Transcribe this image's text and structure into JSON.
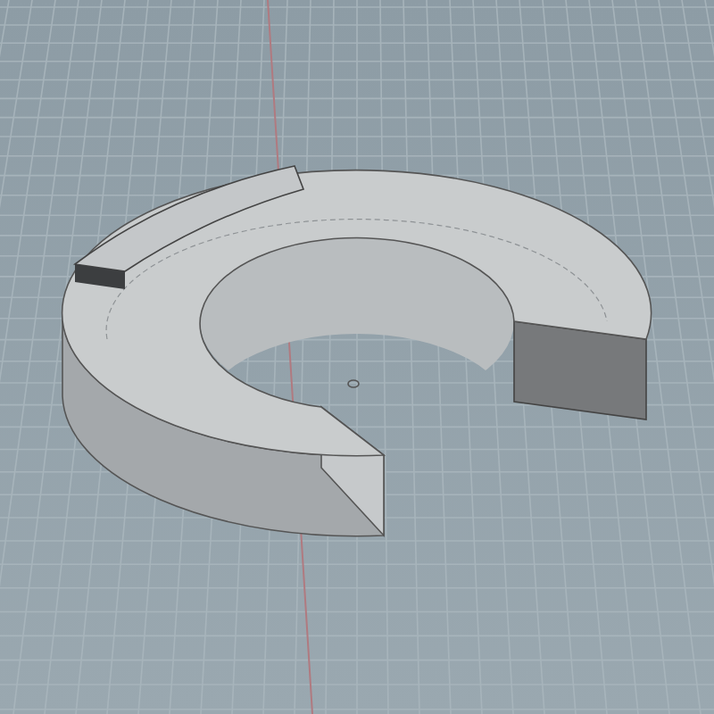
{
  "viewport": {
    "grid": true,
    "axes": true,
    "model": {
      "kind": "c-ring"
    }
  }
}
